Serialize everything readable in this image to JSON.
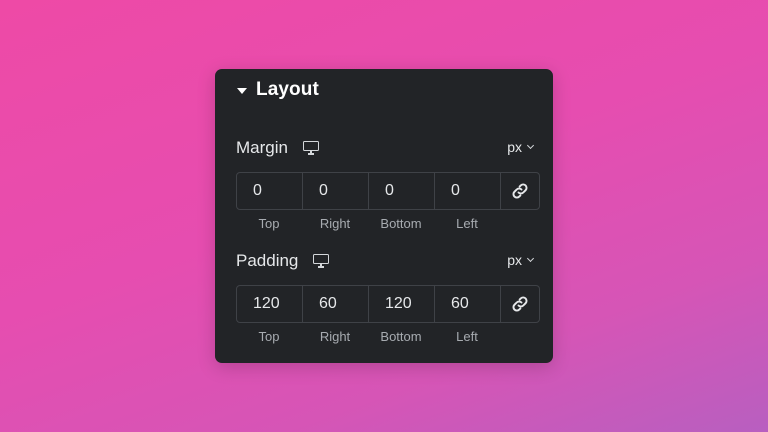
{
  "panel": {
    "title": "Layout"
  },
  "margin": {
    "label": "Margin",
    "device_icon": "desktop-monitor-icon",
    "unit": "px",
    "values": [
      "0",
      "0",
      "0",
      "0"
    ],
    "sides": [
      "Top",
      "Right",
      "Bottom",
      "Left"
    ],
    "link_icon": "link-icon"
  },
  "padding": {
    "label": "Padding",
    "device_icon": "desktop-monitor-icon",
    "unit": "px",
    "values": [
      "120",
      "60",
      "120",
      "60"
    ],
    "sides": [
      "Top",
      "Right",
      "Bottom",
      "Left"
    ],
    "link_icon": "link-icon"
  },
  "colors": {
    "panel_bg": "#222427",
    "border": "#3f4247",
    "text": "#e6e8ea",
    "muted_text": "#a7abb0",
    "background_gradient": [
      "#ee4aa6",
      "#b85fc0"
    ]
  }
}
